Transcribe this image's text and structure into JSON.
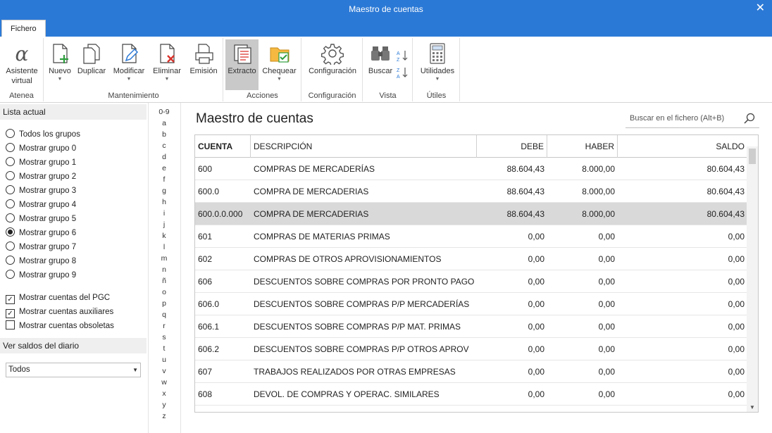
{
  "window": {
    "title": "Maestro de cuentas",
    "close_glyph": "✕"
  },
  "tabs": [
    {
      "label": "Fichero"
    }
  ],
  "ribbon": {
    "groups": {
      "atenea": "Atenea",
      "mantenimiento": "Mantenimiento",
      "acciones": "Acciones",
      "configuracion": "Configuración",
      "vista": "Vista",
      "utiles": "Útiles"
    },
    "buttons": {
      "asistente": "Asistente virtual",
      "nuevo": "Nuevo",
      "duplicar": "Duplicar",
      "modificar": "Modificar",
      "eliminar": "Eliminar",
      "emision": "Emisión",
      "extracto": "Extracto",
      "chequear": "Chequear",
      "configuracion": "Configuración",
      "buscar": "Buscar",
      "utilidades": "Utilidades"
    }
  },
  "left_panel": {
    "lista_actual_header": "Lista actual",
    "groups": [
      {
        "label": "Todos los grupos",
        "checked": false
      },
      {
        "label": "Mostrar grupo 0",
        "checked": false
      },
      {
        "label": "Mostrar grupo 1",
        "checked": false
      },
      {
        "label": "Mostrar grupo 2",
        "checked": false
      },
      {
        "label": "Mostrar grupo 3",
        "checked": false
      },
      {
        "label": "Mostrar grupo 4",
        "checked": false
      },
      {
        "label": "Mostrar grupo 5",
        "checked": false
      },
      {
        "label": "Mostrar grupo 6",
        "checked": true
      },
      {
        "label": "Mostrar grupo 7",
        "checked": false
      },
      {
        "label": "Mostrar grupo 8",
        "checked": false
      },
      {
        "label": "Mostrar grupo 9",
        "checked": false
      }
    ],
    "checkboxes": [
      {
        "label": "Mostrar cuentas del PGC",
        "checked": true
      },
      {
        "label": "Mostrar cuentas auxiliares",
        "checked": true
      },
      {
        "label": "Mostrar cuentas obsoletas",
        "checked": false
      }
    ],
    "saldos_header": "Ver saldos del diario",
    "saldos_value": "Todos"
  },
  "letters": [
    "0-9",
    "a",
    "b",
    "c",
    "d",
    "e",
    "f",
    "g",
    "h",
    "i",
    "j",
    "k",
    "l",
    "m",
    "n",
    "ñ",
    "o",
    "p",
    "q",
    "r",
    "s",
    "t",
    "u",
    "v",
    "w",
    "x",
    "y",
    "z"
  ],
  "main": {
    "heading": "Maestro de cuentas",
    "search_placeholder": "Buscar en el fichero (Alt+B)",
    "columns": {
      "cuenta": "CUENTA",
      "descripcion": "DESCRIPCIÓN",
      "debe": "DEBE",
      "haber": "HABER",
      "saldo": "SALDO"
    },
    "rows": [
      {
        "cuenta": "600",
        "descripcion": "COMPRAS DE MERCADERÍAS",
        "debe": "88.604,43",
        "haber": "8.000,00",
        "saldo": "80.604,43",
        "selected": false
      },
      {
        "cuenta": "600.0",
        "descripcion": "COMPRA DE MERCADERIAS",
        "debe": "88.604,43",
        "haber": "8.000,00",
        "saldo": "80.604,43",
        "selected": false
      },
      {
        "cuenta": "600.0.0.000",
        "descripcion": "COMPRA DE MERCADERIAS",
        "debe": "88.604,43",
        "haber": "8.000,00",
        "saldo": "80.604,43",
        "selected": true
      },
      {
        "cuenta": "601",
        "descripcion": "COMPRAS DE MATERIAS PRIMAS",
        "debe": "0,00",
        "haber": "0,00",
        "saldo": "0,00",
        "selected": false
      },
      {
        "cuenta": "602",
        "descripcion": "COMPRAS DE OTROS APROVISIONAMIENTOS",
        "debe": "0,00",
        "haber": "0,00",
        "saldo": "0,00",
        "selected": false
      },
      {
        "cuenta": "606",
        "descripcion": "DESCUENTOS SOBRE COMPRAS POR PRONTO PAGO",
        "debe": "0,00",
        "haber": "0,00",
        "saldo": "0,00",
        "selected": false
      },
      {
        "cuenta": "606.0",
        "descripcion": "DESCUENTOS SOBRE COMPRAS P/P MERCADERÍAS",
        "debe": "0,00",
        "haber": "0,00",
        "saldo": "0,00",
        "selected": false
      },
      {
        "cuenta": "606.1",
        "descripcion": "DESCUENTOS SOBRE COMPRAS P/P MAT. PRIMAS",
        "debe": "0,00",
        "haber": "0,00",
        "saldo": "0,00",
        "selected": false
      },
      {
        "cuenta": "606.2",
        "descripcion": "DESCUENTOS SOBRE COMPRAS P/P OTROS APROV",
        "debe": "0,00",
        "haber": "0,00",
        "saldo": "0,00",
        "selected": false
      },
      {
        "cuenta": "607",
        "descripcion": "TRABAJOS REALIZADOS POR OTRAS EMPRESAS",
        "debe": "0,00",
        "haber": "0,00",
        "saldo": "0,00",
        "selected": false
      },
      {
        "cuenta": "608",
        "descripcion": "DEVOL. DE COMPRAS Y OPERAC. SIMILARES",
        "debe": "0,00",
        "haber": "0,00",
        "saldo": "0,00",
        "selected": false
      }
    ]
  },
  "colors": {
    "titlebar": "#2b79d6",
    "selected_row": "#d9d9d9",
    "accent_green": "#2e9e3e",
    "accent_red": "#d9322b"
  }
}
